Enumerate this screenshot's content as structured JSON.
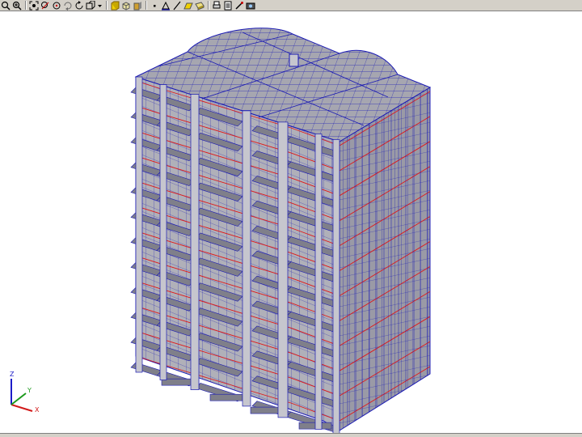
{
  "toolbar": {
    "groups": [
      [
        "zoom-icon",
        "zoom-window-icon"
      ],
      [
        "zoom-extents-icon",
        "zoom-fit-icon",
        "rotate-icon",
        "rotate-x-icon",
        "rotate-z-icon",
        "view-select-icon"
      ],
      [
        "solid-view-icon",
        "box-view-icon",
        "shaded-view-icon"
      ],
      [
        "node-icon",
        "support-icon",
        "line-element-icon",
        "plate-element-icon",
        "solid-element-icon"
      ],
      [
        "print-icon",
        "document-icon",
        "tools-icon",
        "camera-icon"
      ]
    ]
  },
  "colors": {
    "toolbar_bg": "#d4d0c8",
    "mesh_fill": "#a6a6b0",
    "mesh_dark": "#7f7f8a",
    "mesh_light": "#c6c6ce",
    "mesh_line": "#1b1bb4",
    "storey_line": "#e01818",
    "axis_x": "#d21a1a",
    "axis_y": "#1c9a1c",
    "axis_z": "#1c1cc8"
  },
  "model": {
    "storeys": 12,
    "view": "isometric"
  },
  "axes": {
    "x_label": "X",
    "y_label": "Y",
    "z_label": "Z"
  }
}
